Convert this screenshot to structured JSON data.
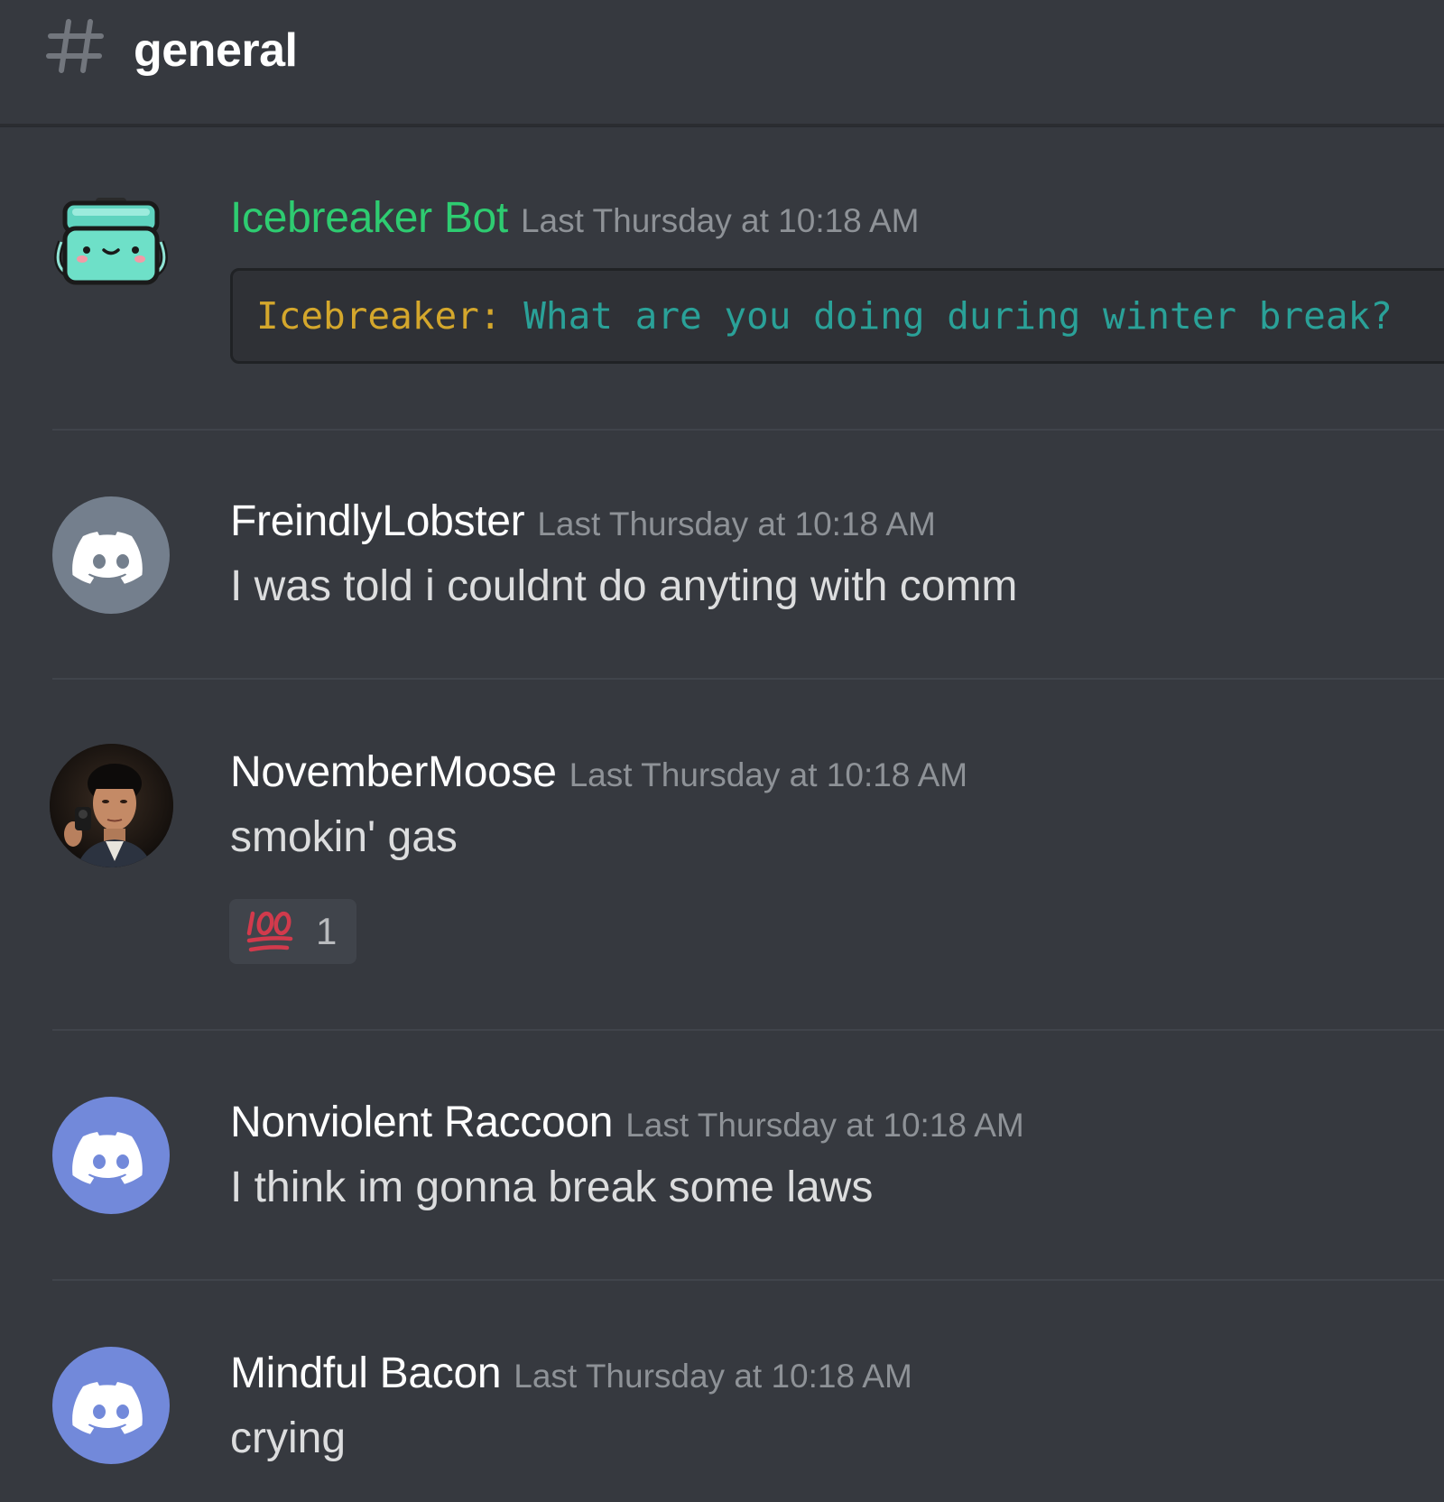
{
  "channel": {
    "icon": "hash-icon",
    "name": "general"
  },
  "messages": [
    {
      "author": "Icebreaker Bot",
      "timestamp": "Last Thursday at 10:18 AM",
      "avatar": "icebreaker-cooler-avatar",
      "is_bot": true,
      "code": {
        "key": "Icebreaker:",
        "value": "What are you doing during winter break?"
      }
    },
    {
      "author": "FreindlyLobster",
      "timestamp": "Last Thursday at 10:18 AM",
      "avatar": "discord-default-avatar-grey",
      "text": "I was told i couldnt do anyting with comm"
    },
    {
      "author": "NovemberMoose",
      "timestamp": "Last Thursday at 10:18 AM",
      "avatar": "user-photo-avatar",
      "text": "smokin' gas",
      "reaction": {
        "emoji": "hundred-points-icon",
        "count": "1"
      }
    },
    {
      "author": "Nonviolent Raccoon",
      "timestamp": "Last Thursday at 10:18 AM",
      "avatar": "discord-default-avatar-blurple",
      "text": "I think im gonna break some laws"
    },
    {
      "author": "Mindful Bacon",
      "timestamp": "Last Thursday at 10:18 AM",
      "avatar": "discord-default-avatar-blurple",
      "text": "crying"
    }
  ],
  "colors": {
    "background": "#36393f",
    "bot_name": "#2ecc71",
    "timestamp": "#8e9297",
    "code_key": "#d4a72c",
    "code_value": "#2aa198",
    "avatar_grey": "#747f8d",
    "avatar_blurple": "#7289da"
  }
}
